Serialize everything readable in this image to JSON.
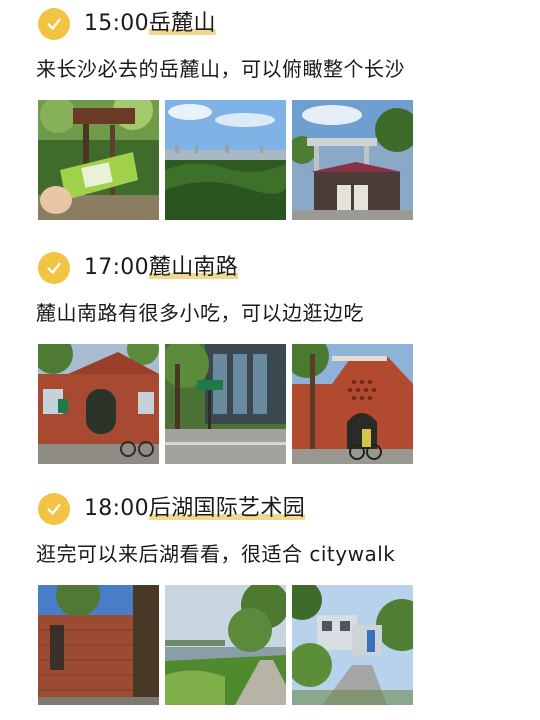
{
  "sections": [
    {
      "time": "15:00",
      "place": "岳麓山",
      "description": "来长沙必去的岳麓山，可以俯瞰整个长沙",
      "photo_icons": [
        "forest-ticket-photo",
        "city-overlook-photo",
        "pavilion-entrance-photo"
      ]
    },
    {
      "time": "17:00",
      "place": "麓山南路",
      "description": "麓山南路有很多小吃，可以边逛边吃",
      "photo_icons": [
        "brick-building-photo",
        "street-sign-photo",
        "brick-arch-photo"
      ]
    },
    {
      "time": "18:00",
      "place": "后湖国际艺术园",
      "description": "逛完可以来后湖看看，很适合 citywalk",
      "photo_icons": [
        "brick-wall-photo",
        "lakeside-path-photo",
        "village-road-photo"
      ]
    }
  ],
  "colors": {
    "check_badge": "#f3c343",
    "highlight": "#f0d98f",
    "text": "#1a1a1a"
  }
}
